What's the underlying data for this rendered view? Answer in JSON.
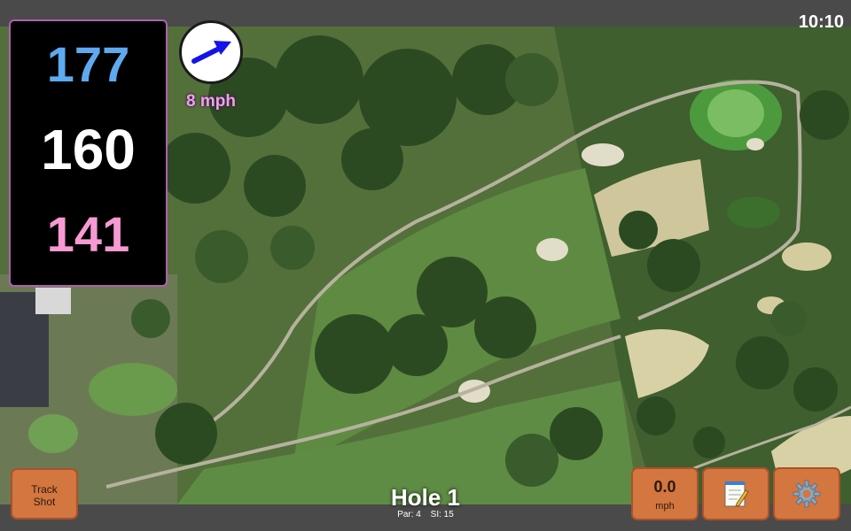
{
  "status": {
    "time": "10:10"
  },
  "yardage": {
    "back": "177",
    "center": "160",
    "front": "141"
  },
  "wind": {
    "speed": "8 mph",
    "icon": "wind-direction-arrow-icon"
  },
  "hole": {
    "title": "Hole 1",
    "par": "Par: 4",
    "stroke_index": "SI: 15"
  },
  "buttons": {
    "track_shot": "Track Shot",
    "speed_value": "0.0",
    "speed_unit": "mph",
    "notes_icon": "notepad-icon",
    "settings_icon": "gear-icon"
  },
  "colors": {
    "back_yardage": "#5eaaf0",
    "center_yardage": "#ffffff",
    "front_yardage": "#f79ad2",
    "button_bg": "#d3763f",
    "wind_text": "#f0a0f0"
  }
}
